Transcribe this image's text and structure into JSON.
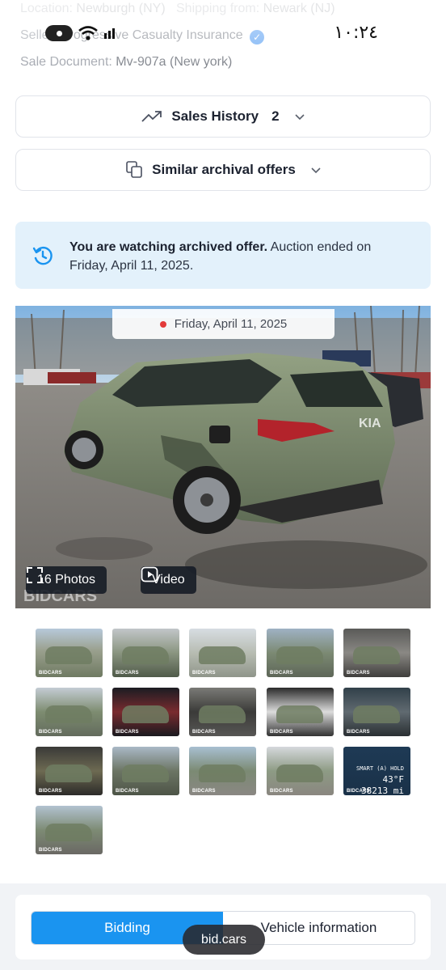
{
  "info": {
    "location_label": "Location:",
    "location_value": "Newburgh (NY)",
    "shipping_label": "Shipping from:",
    "shipping_value": "Newark (NJ)",
    "seller_label": "Seller:",
    "seller_value": "Progressive Casualty Insurance",
    "sale_doc_label": "Sale Document:",
    "sale_doc_value": "Mv-907a (New york)"
  },
  "status_bar": {
    "time": "١٠:٢٤"
  },
  "sales_history": {
    "label": "Sales History",
    "count": "2"
  },
  "similar_offers": {
    "label": "Similar archival offers"
  },
  "archived_notice": {
    "bold": "You are watching archived offer.",
    "text": "Auction ended on Friday, April 11, 2025."
  },
  "photo": {
    "date": "Friday, April 11, 2025",
    "photos_button": "16 Photos",
    "video_button": "Video",
    "watermark": "BIDCARS"
  },
  "thumbnails": {
    "count": 16,
    "odometer_header": "SMART (A) HOLD",
    "odometer_temp": "43°F",
    "odometer_miles": "38213 mi",
    "thumb_logo": "BIDCARS"
  },
  "tabs": [
    {
      "label": "Bidding",
      "active": true
    },
    {
      "label": "Vehicle information",
      "active": false
    }
  ],
  "overlay_pill": "bid.cars",
  "colors": {
    "accent": "#1a94f0",
    "notice_bg": "#e3f1fb",
    "car_green": "#7b8a6e",
    "dark_button": "#161c26"
  }
}
